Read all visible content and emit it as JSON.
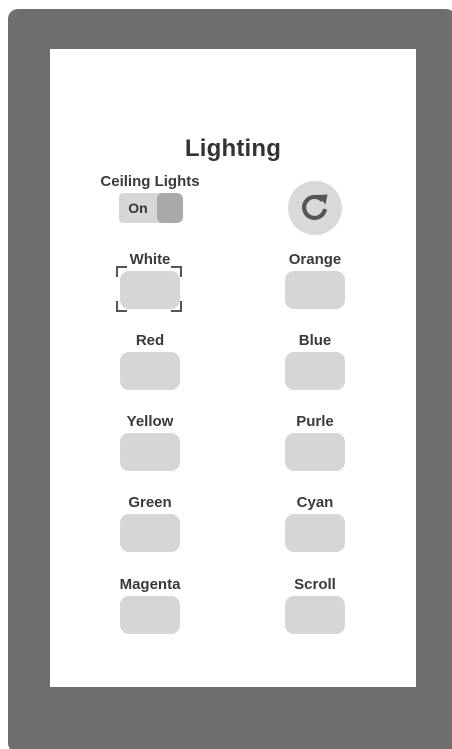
{
  "screen": {
    "title": "Lighting"
  },
  "ceiling_lights": {
    "label": "Ceiling Lights",
    "toggle_state": "On"
  },
  "refresh": {
    "icon": "refresh-icon"
  },
  "colors": {
    "device_frame": "#6f6f6f",
    "button": "#d6d6d6",
    "toggle_thumb": "#a9a9a9",
    "refresh_icon": "#555555"
  },
  "color_buttons": [
    {
      "label": "White",
      "selected": true
    },
    {
      "label": "Orange"
    },
    {
      "label": "Red"
    },
    {
      "label": "Blue"
    },
    {
      "label": "Yellow"
    },
    {
      "label": "Purle"
    },
    {
      "label": "Green"
    },
    {
      "label": "Cyan"
    },
    {
      "label": "Magenta"
    },
    {
      "label": "Scroll"
    }
  ]
}
